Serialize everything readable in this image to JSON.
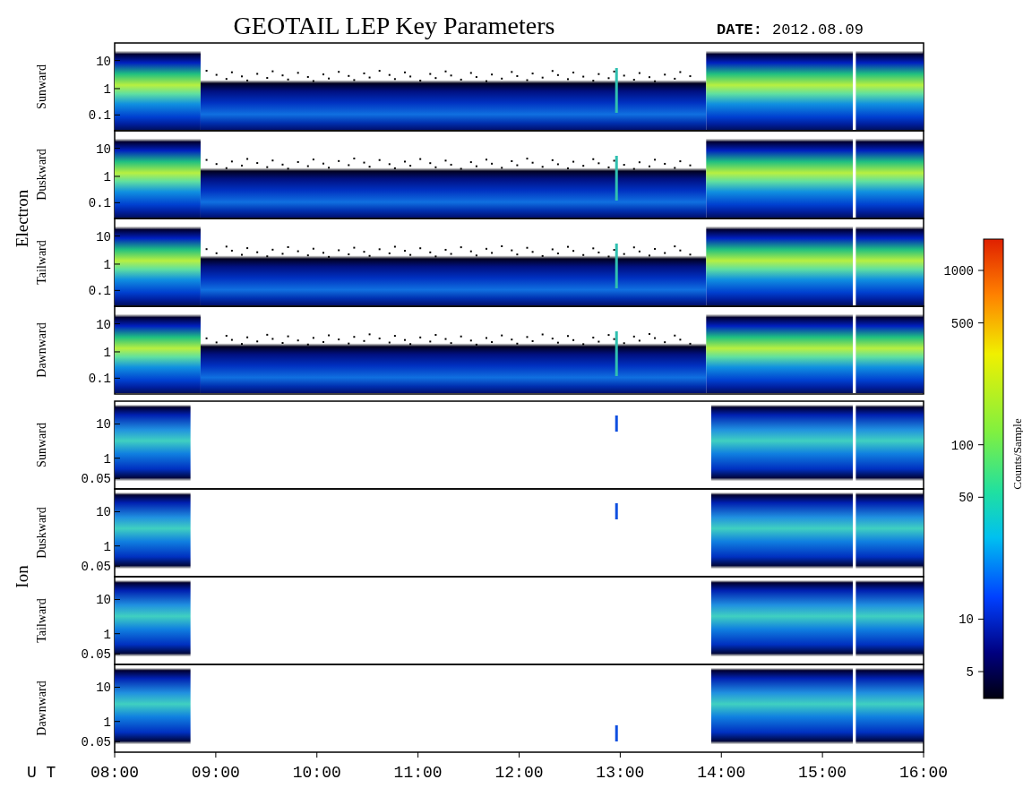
{
  "title": "GEOTAIL LEP Key Parameters",
  "date_label": "DATE:",
  "date": "2012.08.09",
  "groups": [
    {
      "name": "Electron",
      "kind": "electron",
      "panels": [
        {
          "direction": "Sunward",
          "yticks": [
            "10",
            "1",
            "0.1"
          ]
        },
        {
          "direction": "Duskward",
          "yticks": [
            "10",
            "1",
            "0.1"
          ]
        },
        {
          "direction": "Tailward",
          "yticks": [
            "10",
            "1",
            "0.1"
          ]
        },
        {
          "direction": "Dawnward",
          "yticks": [
            "10",
            "1",
            "0.1"
          ]
        }
      ]
    },
    {
      "name": "Ion",
      "kind": "ion",
      "panels": [
        {
          "direction": "Sunward",
          "yticks": [
            "10",
            "1",
            "0.05"
          ]
        },
        {
          "direction": "Duskward",
          "yticks": [
            "10",
            "1",
            "0.05"
          ]
        },
        {
          "direction": "Tailward",
          "yticks": [
            "10",
            "1",
            "0.05"
          ]
        },
        {
          "direction": "Dawnward",
          "yticks": [
            "10",
            "1",
            "0.05"
          ]
        }
      ]
    }
  ],
  "x_axis": {
    "label": "U T",
    "ticks": [
      "08:00",
      "09:00",
      "10:00",
      "11:00",
      "12:00",
      "13:00",
      "14:00",
      "15:00",
      "16:00"
    ]
  },
  "colorbar": {
    "label": "Counts/Sample",
    "ticks": [
      "1000",
      "500",
      "100",
      "50",
      "10",
      "5"
    ]
  }
}
